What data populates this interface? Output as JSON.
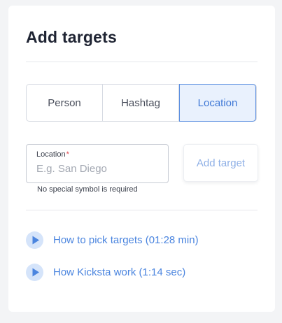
{
  "panel": {
    "title": "Add targets"
  },
  "target_types": {
    "options": [
      "Person",
      "Hashtag",
      "Location"
    ],
    "selected": "Location"
  },
  "location_field": {
    "label": "Location",
    "required_marker": "*",
    "value": "",
    "placeholder": "E.g. San Diego",
    "hint": "No special symbol is required"
  },
  "add_button": {
    "label": "Add target"
  },
  "help_videos": [
    {
      "label": "How to pick targets (01:28 min)",
      "icon": "play-circle-icon"
    },
    {
      "label": "How Kicksta work (1:14 sec)",
      "icon": "play-circle-icon"
    }
  ],
  "colors": {
    "accent": "#3f78d6",
    "accent_bg": "#e9f1fd",
    "link": "#4b85df",
    "play_icon_fill": "#d5e4fa",
    "required": "#e0464d"
  }
}
